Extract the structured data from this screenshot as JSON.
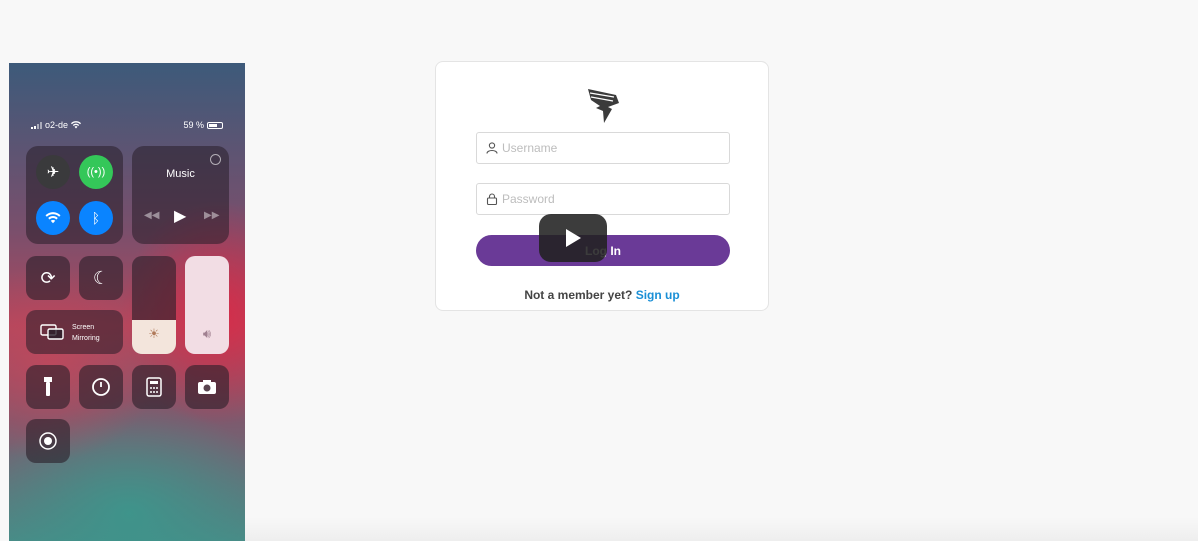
{
  "phone": {
    "carrier": "o2-de",
    "battery": "59 %",
    "music_label": "Music",
    "screen_mirroring_line1": "Screen",
    "screen_mirroring_line2": "Mirroring",
    "colors": {
      "airplane_bg": "#3a3a3c",
      "cellular_bg": "#34c759",
      "wifi_bg": "#0a84ff",
      "bluetooth_bg": "#0a84ff"
    },
    "icons": [
      "airplane-icon",
      "cellular-icon",
      "wifi-icon",
      "bluetooth-icon",
      "rotation-lock-icon",
      "moon-icon",
      "screen-mirroring-icon",
      "brightness-icon",
      "volume-icon",
      "flashlight-icon",
      "timer-icon",
      "calculator-icon",
      "camera-icon",
      "record-icon"
    ],
    "brightness_level": 0.35,
    "volume_level": 1.0
  },
  "login": {
    "username_placeholder": "Username",
    "password_placeholder": "Password",
    "login_label": "Log In",
    "not_member_text": "Not a member yet?",
    "signup_label": "Sign up",
    "brand_color": "#6a3a97",
    "link_color": "#1a8fd6"
  },
  "video": {
    "play_icon": "play-icon"
  }
}
